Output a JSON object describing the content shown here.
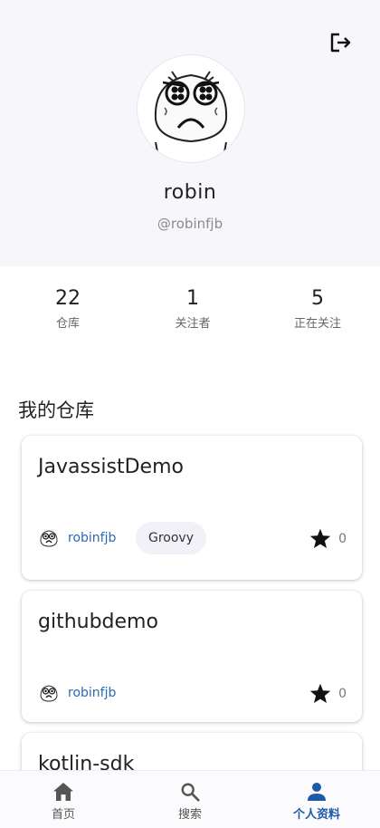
{
  "profile": {
    "username": "robin",
    "handle": "@robinfjb"
  },
  "stats": [
    {
      "value": "22",
      "label": "仓库"
    },
    {
      "value": "1",
      "label": "关注者"
    },
    {
      "value": "5",
      "label": "正在关注"
    }
  ],
  "repos_section": {
    "title": "我的仓库"
  },
  "repos": [
    {
      "name": "JavassistDemo",
      "owner": "robinfjb",
      "language": "Groovy",
      "stars": "0"
    },
    {
      "name": "githubdemo",
      "owner": "robinfjb",
      "stars": "0"
    },
    {
      "name": "kotlin-sdk"
    }
  ],
  "bottom_nav": [
    {
      "label": "首页",
      "icon": "home-icon"
    },
    {
      "label": "搜索",
      "icon": "search-icon"
    },
    {
      "label": "个人资料",
      "icon": "person-icon",
      "active": true
    }
  ],
  "colors": {
    "header_bg": "#f6f6fb",
    "link": "#2a6ab5",
    "active_nav": "#1e5aa8",
    "chip_bg": "#f1f1f7"
  }
}
